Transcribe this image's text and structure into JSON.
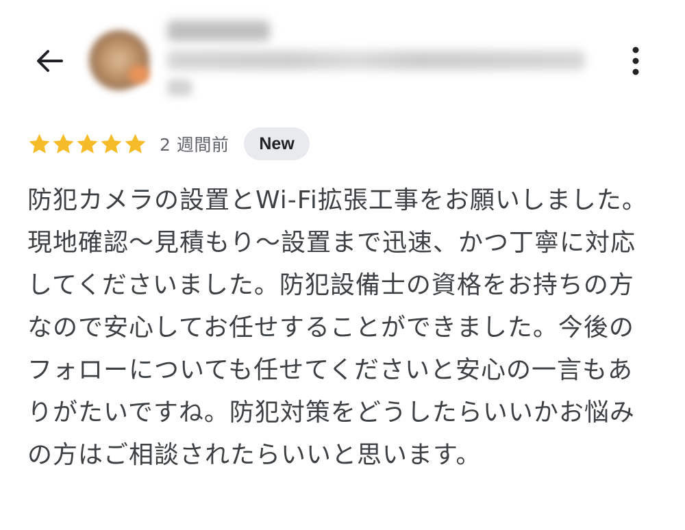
{
  "header": {
    "back_icon": "arrow-left-icon",
    "reviewer_name": "",
    "reviewer_meta": "",
    "more_icon": "more-vertical-icon"
  },
  "review": {
    "rating": 5,
    "rating_max": 5,
    "star_color": "#f6bb29",
    "time_ago": "2 週間前",
    "badge": "New",
    "text": "防犯カメラの設置とWi-Fi拡張工事をお願いしました。現地確認〜見積もり〜設置まで迅速、かつ丁寧に対応してくださいました。防犯設備士の資格をお持ちの方なので安心してお任せすることができました。今後のフォローについても任せてくださいと安心の一言もありがたいですね。防犯対策をどうしたらいいかお悩みの方はご相談されたらいいと思います。"
  }
}
